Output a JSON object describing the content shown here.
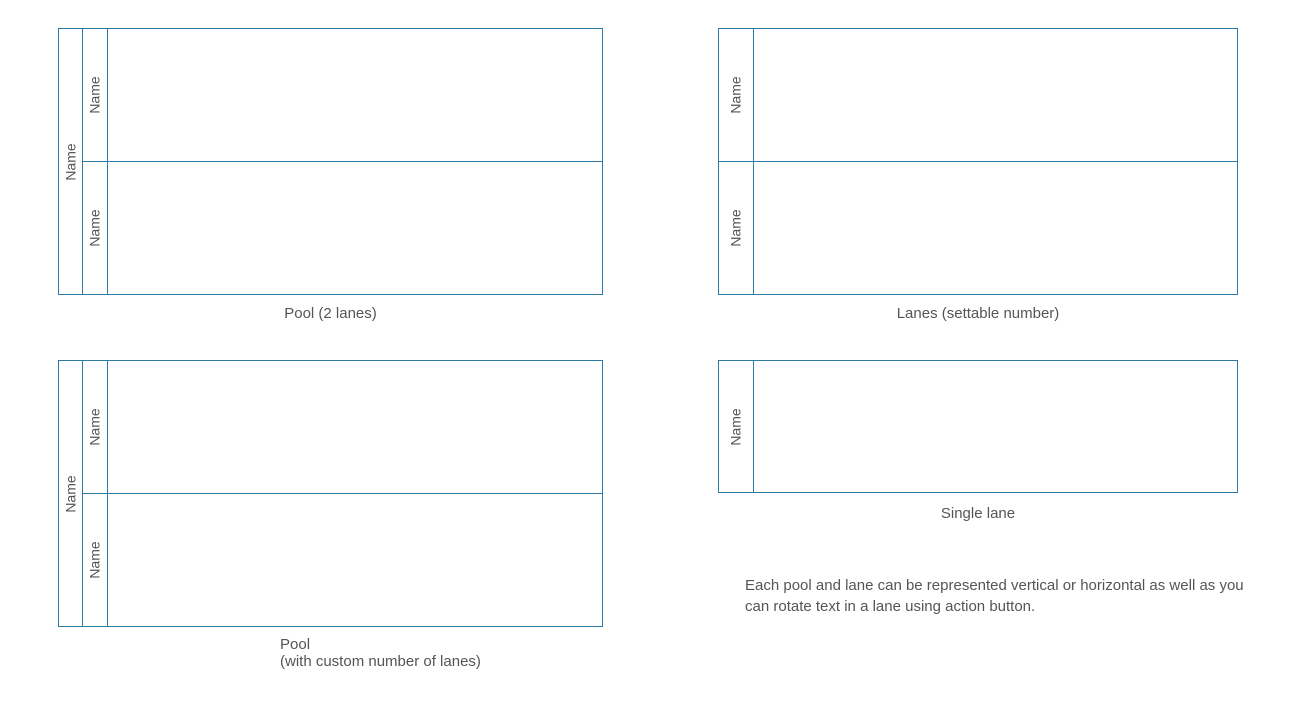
{
  "diagrams": {
    "pool2": {
      "pool_label": "Name",
      "lanes": [
        "Name",
        "Name"
      ],
      "caption": "Pool (2 lanes)"
    },
    "lanes_settable": {
      "lanes": [
        "Name",
        "Name"
      ],
      "caption": "Lanes (settable number)"
    },
    "pool_custom": {
      "pool_label": "Name",
      "lanes": [
        "Name",
        "Name"
      ],
      "caption_line1": "Pool",
      "caption_line2": "(with custom number of lanes)"
    },
    "single_lane": {
      "lane_label": "Name",
      "caption": "Single lane"
    }
  },
  "note": "Each pool and lane can be represented vertical or horizontal as well as you can rotate text in a lane using action button."
}
